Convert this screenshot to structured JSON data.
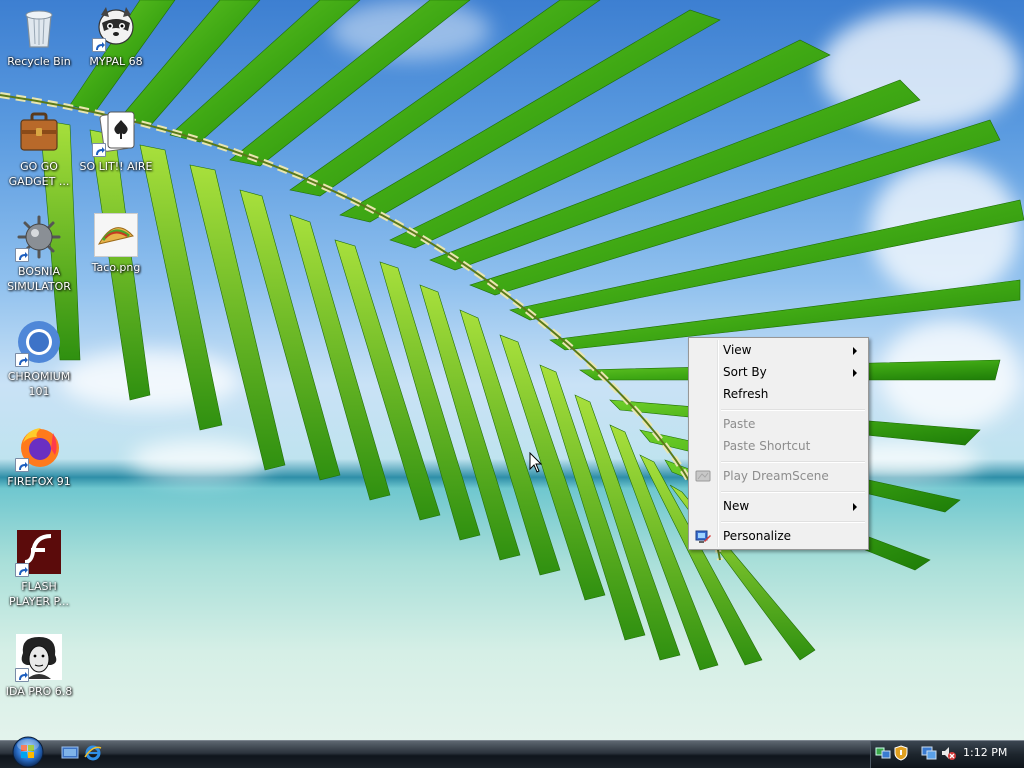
{
  "desktop": {
    "icons": [
      {
        "name": "recycle-bin",
        "label": "Recycle Bin"
      },
      {
        "name": "mypal",
        "label": "MYPAL 68"
      },
      {
        "name": "gogo-gadget",
        "label": "GO GO\nGADGET ..."
      },
      {
        "name": "solitaire",
        "label": "SO LIT!! AIRE"
      },
      {
        "name": "bosnia-simulator",
        "label": "BOSNIA\nSIMULATOR"
      },
      {
        "name": "taco",
        "label": "Taco.png"
      },
      {
        "name": "chromium",
        "label": "CHROMIUM\n101"
      },
      {
        "name": "firefox",
        "label": "FIREFOX 91"
      },
      {
        "name": "flash-player",
        "label": "FLASH\nPLAYER P..."
      },
      {
        "name": "ida-pro",
        "label": "IDA PRO 6.8"
      }
    ]
  },
  "context_menu": {
    "items": [
      {
        "label": "View",
        "enabled": true,
        "submenu": true
      },
      {
        "label": "Sort By",
        "enabled": true,
        "submenu": true
      },
      {
        "label": "Refresh",
        "enabled": true,
        "submenu": false
      },
      {
        "label": "Paste",
        "enabled": false,
        "submenu": false
      },
      {
        "label": "Paste Shortcut",
        "enabled": false,
        "submenu": false
      },
      {
        "label": "Play DreamScene",
        "enabled": false,
        "submenu": false,
        "icon": "dreamscene-icon"
      },
      {
        "label": "New",
        "enabled": true,
        "submenu": true
      },
      {
        "label": "Personalize",
        "enabled": true,
        "submenu": false,
        "icon": "personalize-icon"
      }
    ]
  },
  "taskbar": {
    "start_icon": "windows-orb-icon",
    "quick_launch": [
      "show-desktop-icon",
      "internet-explorer-icon"
    ],
    "tray_icons": [
      "network-icon",
      "security-icon",
      "monitor-icon",
      "volume-muted-icon"
    ],
    "clock": "1:12 PM"
  },
  "colors": {
    "menu_bg": "#f0f0f0",
    "menu_border": "#979797",
    "disabled_text": "#8d8d8d",
    "taskbar": "#1b2229"
  }
}
